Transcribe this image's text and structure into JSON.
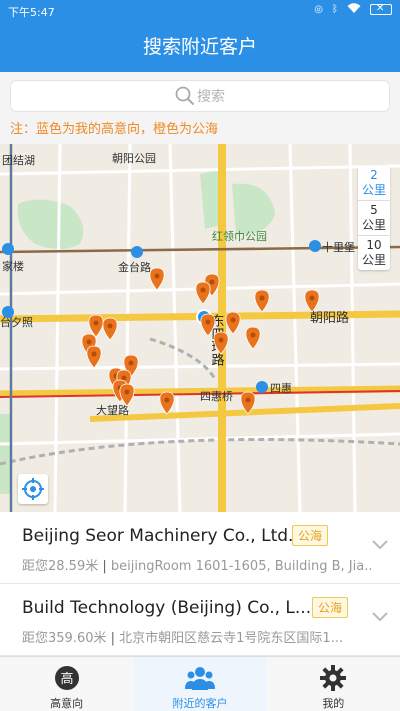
{
  "status_bar": {
    "time": "下午5:47"
  },
  "nav": {
    "title": "搜索附近客户"
  },
  "search": {
    "placeholder": "搜索"
  },
  "notice": "注：蓝色为我的高意向，橙色为公海",
  "map": {
    "labels": [
      "团结湖",
      "朝阳公园",
      "金台路",
      "红领巾公园",
      "十里堡",
      "家楼",
      "台夕照",
      "东四环路",
      "朝阳路",
      "四惠桥",
      "四惠",
      "大望路"
    ],
    "scale_options": [
      {
        "value": "2",
        "unit": "公里",
        "active": true
      },
      {
        "value": "5",
        "unit": "公里",
        "active": false
      },
      {
        "value": "10",
        "unit": "公里",
        "active": false
      }
    ],
    "marker_colors": {
      "public": "#e8731c",
      "mine": "#2b8fe6"
    }
  },
  "customers": [
    {
      "name": "Beijing Seor Machinery Co., Ltd.",
      "tag": "公海",
      "distance": "距您28.59米",
      "address": "beijingRoom 1601-1605, Building B, Jia..."
    },
    {
      "name": "Build Technology (Beijing) Co., L...",
      "tag": "公海",
      "distance": "距您359.60米",
      "address": "北京市朝阳区慈云寺1号院东区国际1..."
    }
  ],
  "tabs": [
    {
      "label": "高意向",
      "icon_text": "高",
      "active": false
    },
    {
      "label": "附近的客户",
      "active": true
    },
    {
      "label": "我的",
      "active": false
    }
  ]
}
